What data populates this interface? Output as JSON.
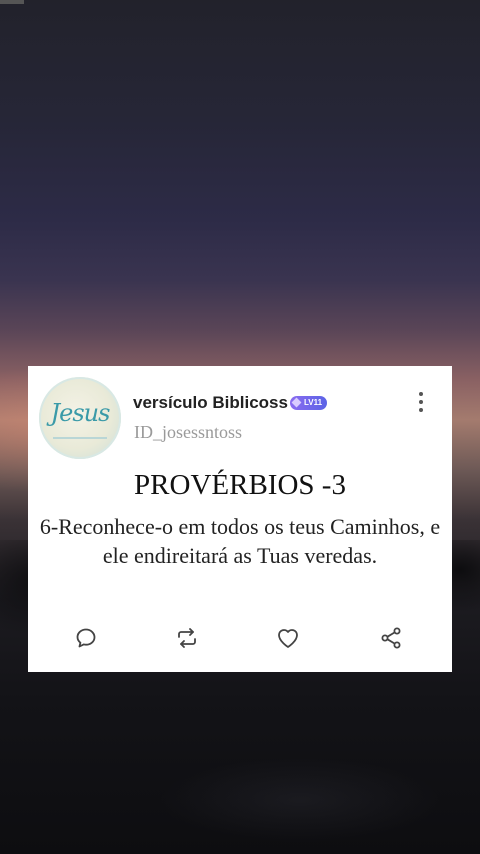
{
  "post": {
    "username": "versículo Biblicoss",
    "level_badge": "LV11",
    "handle": "ID_josessntoss",
    "title": "PROVÉRBIOS -3",
    "verse": "6-Reconhece-o em todos os teus Caminhos, e ele endireitará as Tuas veredas.",
    "avatar": {
      "label": "Jesus",
      "icon": "profile-avatar-jesus-logo"
    }
  },
  "actions": [
    {
      "name": "comment",
      "icon": "speech-bubble-icon"
    },
    {
      "name": "repost",
      "icon": "repost-arrows-icon"
    },
    {
      "name": "like",
      "icon": "heart-icon"
    },
    {
      "name": "share",
      "icon": "share-icon"
    }
  ],
  "colors": {
    "card_background": "#ffffff",
    "badge_gradient_start": "#8b6cf0",
    "badge_gradient_end": "#5b63e6",
    "icon_color": "#444444"
  }
}
